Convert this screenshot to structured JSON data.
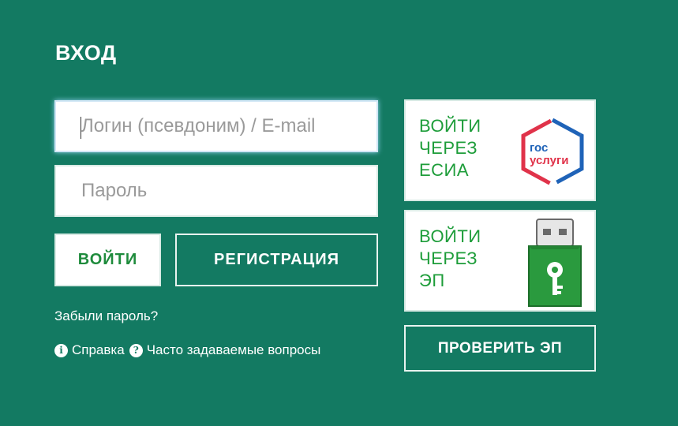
{
  "page": {
    "title": "ВХОД"
  },
  "form": {
    "login_placeholder": "Логин (псевдоним) / E-mail",
    "login_value": "",
    "password_placeholder": "Пароль",
    "password_value": "",
    "login_button": "ВОЙТИ",
    "register_button": "РЕГИСТРАЦИЯ",
    "forgot_link": "Забыли пароль?"
  },
  "help": {
    "help_link": "Справка",
    "faq_link": "Часто задаваемые вопросы",
    "help_icon": "info-icon",
    "faq_icon": "question-icon"
  },
  "esia": {
    "line1": "ВОЙТИ",
    "line2": "ЧЕРЕЗ",
    "line3": "ЕСИА",
    "logo_line1": "гос",
    "logo_line2": "услуги",
    "logo_icon": "gosuslugi-logo"
  },
  "ep": {
    "line1": "ВОЙТИ",
    "line2": "ЧЕРЕЗ",
    "line3": "ЭП",
    "icon": "usb-key-icon"
  },
  "check_ep_button": "ПРОВЕРИТЬ ЭП",
  "colors": {
    "background": "#137a62",
    "accent_green": "#1e9d3a",
    "logo_blue": "#1f63b8",
    "logo_red": "#e0334a"
  }
}
